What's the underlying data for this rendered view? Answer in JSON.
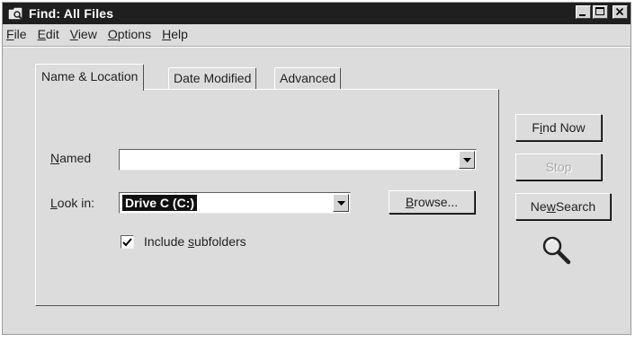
{
  "window": {
    "title": "Find: All Files"
  },
  "menu": [
    {
      "label": "File",
      "key": "F",
      "rest": "ile"
    },
    {
      "label": "Edit",
      "key": "E",
      "rest": "dit"
    },
    {
      "label": "View",
      "key": "V",
      "rest": "iew"
    },
    {
      "label": "Options",
      "key": "O",
      "rest": "ptions"
    },
    {
      "label": "Help",
      "key": "H",
      "rest": "elp"
    }
  ],
  "tabs": {
    "name_location": "Name & Location",
    "date_modified": "Date Modified",
    "advanced": "Advanced"
  },
  "form": {
    "named_key": "N",
    "named_rest": "amed",
    "named_value": "",
    "lookin_key": "L",
    "lookin_rest": "ook in:",
    "lookin_value": "Drive C (C:)",
    "browse_key": "B",
    "browse_rest": "rowse...",
    "include_subfolders_pre": "Include ",
    "include_subfolders_key": "s",
    "include_subfolders_rest": "ubfolders",
    "include_subfolders_checked": true
  },
  "buttons": {
    "find_now_key": "i",
    "find_now_pre": "F",
    "find_now_rest": "nd Now",
    "stop": "Stop",
    "new_search_pre": "Ne",
    "new_search_key": "w",
    "new_search_rest": " Search"
  },
  "colors": {
    "titlebar": "#1f1f1f",
    "face": "#dcdcdc",
    "selection": "#101010"
  },
  "icons": {
    "app": "find-app-icon",
    "search": "magnifier-icon"
  }
}
